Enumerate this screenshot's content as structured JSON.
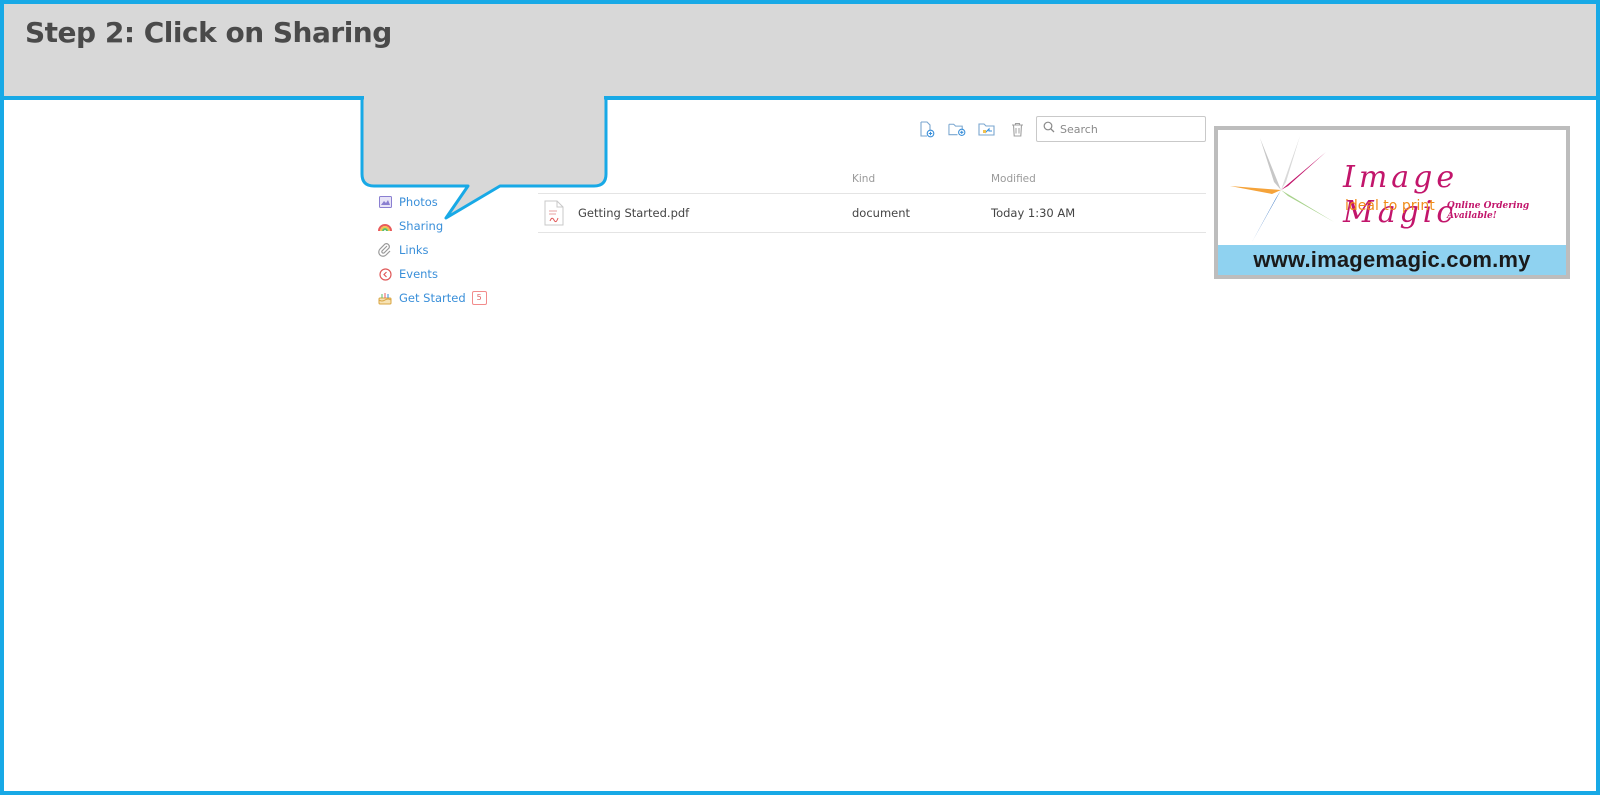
{
  "header": {
    "title": "Step 2: Click on Sharing"
  },
  "sidebar": {
    "items": [
      {
        "label": "Photos",
        "icon": "photos-icon"
      },
      {
        "label": "Sharing",
        "icon": "sharing-rainbow-icon"
      },
      {
        "label": "Links",
        "icon": "paperclip-icon"
      },
      {
        "label": "Events",
        "icon": "clock-icon"
      },
      {
        "label": "Get Started",
        "icon": "cake-icon",
        "badge": "5"
      }
    ]
  },
  "toolbar": {
    "buttons": [
      "new-file-icon",
      "new-folder-icon",
      "shared-folder-icon",
      "trash-icon"
    ]
  },
  "search": {
    "placeholder": "Search",
    "value": ""
  },
  "table": {
    "columns": {
      "kind": "Kind",
      "modified": "Modified"
    },
    "rows": [
      {
        "name": "Getting Started.pdf",
        "kind": "document",
        "modified": "Today 1:30 AM"
      }
    ]
  },
  "ad": {
    "brand": "Image Magic",
    "tagline": "ideal to print",
    "tagline_extra": "Online Ordering Available!",
    "url": "www.imagemagic.com.my"
  },
  "colors": {
    "frame": "#18a9e6",
    "header_bg": "#d8d8d8",
    "link": "#3a8fd9",
    "brand": "#c2156b",
    "tagline": "#f08c1a",
    "url_bar": "#8fd2f0"
  }
}
